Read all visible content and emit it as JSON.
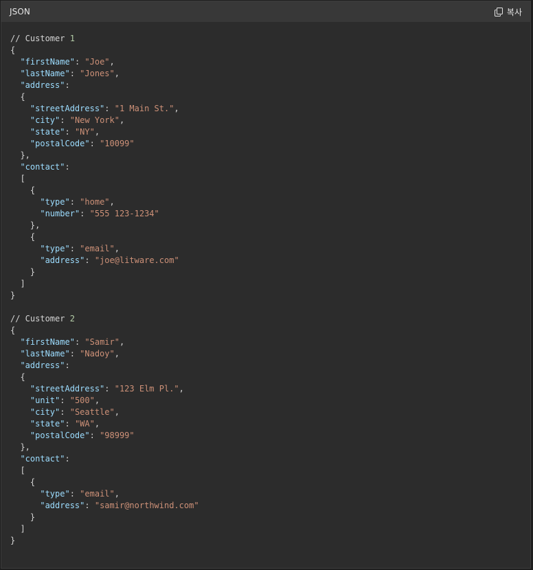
{
  "header": {
    "language": "JSON",
    "copy_label": "복사",
    "copy_icon": "copy-icon"
  },
  "colors": {
    "background": "#2c2c2c",
    "header_background": "#383838",
    "key": "#9cdcfe",
    "string": "#ce9178",
    "number": "#b5cea8",
    "text": "#d4d4d4"
  },
  "code_lines": [
    [
      {
        "t": "comment",
        "v": "// Customer "
      },
      {
        "t": "num",
        "v": "1"
      }
    ],
    [
      {
        "t": "punc",
        "v": "{"
      }
    ],
    [
      {
        "t": "punc",
        "v": "  "
      },
      {
        "t": "key",
        "v": "\"firstName\""
      },
      {
        "t": "punc",
        "v": ": "
      },
      {
        "t": "str",
        "v": "\"Joe\""
      },
      {
        "t": "punc",
        "v": ","
      }
    ],
    [
      {
        "t": "punc",
        "v": "  "
      },
      {
        "t": "key",
        "v": "\"lastName\""
      },
      {
        "t": "punc",
        "v": ": "
      },
      {
        "t": "str",
        "v": "\"Jones\""
      },
      {
        "t": "punc",
        "v": ","
      }
    ],
    [
      {
        "t": "punc",
        "v": "  "
      },
      {
        "t": "key",
        "v": "\"address\""
      },
      {
        "t": "punc",
        "v": ":"
      }
    ],
    [
      {
        "t": "punc",
        "v": "  {"
      }
    ],
    [
      {
        "t": "punc",
        "v": "    "
      },
      {
        "t": "key",
        "v": "\"streetAddress\""
      },
      {
        "t": "punc",
        "v": ": "
      },
      {
        "t": "str",
        "v": "\"1 Main St.\""
      },
      {
        "t": "punc",
        "v": ","
      }
    ],
    [
      {
        "t": "punc",
        "v": "    "
      },
      {
        "t": "key",
        "v": "\"city\""
      },
      {
        "t": "punc",
        "v": ": "
      },
      {
        "t": "str",
        "v": "\"New York\""
      },
      {
        "t": "punc",
        "v": ","
      }
    ],
    [
      {
        "t": "punc",
        "v": "    "
      },
      {
        "t": "key",
        "v": "\"state\""
      },
      {
        "t": "punc",
        "v": ": "
      },
      {
        "t": "str",
        "v": "\"NY\""
      },
      {
        "t": "punc",
        "v": ","
      }
    ],
    [
      {
        "t": "punc",
        "v": "    "
      },
      {
        "t": "key",
        "v": "\"postalCode\""
      },
      {
        "t": "punc",
        "v": ": "
      },
      {
        "t": "str",
        "v": "\"10099\""
      }
    ],
    [
      {
        "t": "punc",
        "v": "  },"
      }
    ],
    [
      {
        "t": "punc",
        "v": "  "
      },
      {
        "t": "key",
        "v": "\"contact\""
      },
      {
        "t": "punc",
        "v": ":"
      }
    ],
    [
      {
        "t": "punc",
        "v": "  ["
      }
    ],
    [
      {
        "t": "punc",
        "v": "    {"
      }
    ],
    [
      {
        "t": "punc",
        "v": "      "
      },
      {
        "t": "key",
        "v": "\"type\""
      },
      {
        "t": "punc",
        "v": ": "
      },
      {
        "t": "str",
        "v": "\"home\""
      },
      {
        "t": "punc",
        "v": ","
      }
    ],
    [
      {
        "t": "punc",
        "v": "      "
      },
      {
        "t": "key",
        "v": "\"number\""
      },
      {
        "t": "punc",
        "v": ": "
      },
      {
        "t": "str",
        "v": "\"555 123-1234\""
      }
    ],
    [
      {
        "t": "punc",
        "v": "    },"
      }
    ],
    [
      {
        "t": "punc",
        "v": "    {"
      }
    ],
    [
      {
        "t": "punc",
        "v": "      "
      },
      {
        "t": "key",
        "v": "\"type\""
      },
      {
        "t": "punc",
        "v": ": "
      },
      {
        "t": "str",
        "v": "\"email\""
      },
      {
        "t": "punc",
        "v": ","
      }
    ],
    [
      {
        "t": "punc",
        "v": "      "
      },
      {
        "t": "key",
        "v": "\"address\""
      },
      {
        "t": "punc",
        "v": ": "
      },
      {
        "t": "str",
        "v": "\"joe@litware.com\""
      }
    ],
    [
      {
        "t": "punc",
        "v": "    }"
      }
    ],
    [
      {
        "t": "punc",
        "v": "  ]"
      }
    ],
    [
      {
        "t": "punc",
        "v": "}"
      }
    ],
    [
      {
        "t": "punc",
        "v": ""
      }
    ],
    [
      {
        "t": "comment",
        "v": "// Customer "
      },
      {
        "t": "num",
        "v": "2"
      }
    ],
    [
      {
        "t": "punc",
        "v": "{"
      }
    ],
    [
      {
        "t": "punc",
        "v": "  "
      },
      {
        "t": "key",
        "v": "\"firstName\""
      },
      {
        "t": "punc",
        "v": ": "
      },
      {
        "t": "str",
        "v": "\"Samir\""
      },
      {
        "t": "punc",
        "v": ","
      }
    ],
    [
      {
        "t": "punc",
        "v": "  "
      },
      {
        "t": "key",
        "v": "\"lastName\""
      },
      {
        "t": "punc",
        "v": ": "
      },
      {
        "t": "str",
        "v": "\"Nadoy\""
      },
      {
        "t": "punc",
        "v": ","
      }
    ],
    [
      {
        "t": "punc",
        "v": "  "
      },
      {
        "t": "key",
        "v": "\"address\""
      },
      {
        "t": "punc",
        "v": ":"
      }
    ],
    [
      {
        "t": "punc",
        "v": "  {"
      }
    ],
    [
      {
        "t": "punc",
        "v": "    "
      },
      {
        "t": "key",
        "v": "\"streetAddress\""
      },
      {
        "t": "punc",
        "v": ": "
      },
      {
        "t": "str",
        "v": "\"123 Elm Pl.\""
      },
      {
        "t": "punc",
        "v": ","
      }
    ],
    [
      {
        "t": "punc",
        "v": "    "
      },
      {
        "t": "key",
        "v": "\"unit\""
      },
      {
        "t": "punc",
        "v": ": "
      },
      {
        "t": "str",
        "v": "\"500\""
      },
      {
        "t": "punc",
        "v": ","
      }
    ],
    [
      {
        "t": "punc",
        "v": "    "
      },
      {
        "t": "key",
        "v": "\"city\""
      },
      {
        "t": "punc",
        "v": ": "
      },
      {
        "t": "str",
        "v": "\"Seattle\""
      },
      {
        "t": "punc",
        "v": ","
      }
    ],
    [
      {
        "t": "punc",
        "v": "    "
      },
      {
        "t": "key",
        "v": "\"state\""
      },
      {
        "t": "punc",
        "v": ": "
      },
      {
        "t": "str",
        "v": "\"WA\""
      },
      {
        "t": "punc",
        "v": ","
      }
    ],
    [
      {
        "t": "punc",
        "v": "    "
      },
      {
        "t": "key",
        "v": "\"postalCode\""
      },
      {
        "t": "punc",
        "v": ": "
      },
      {
        "t": "str",
        "v": "\"98999\""
      }
    ],
    [
      {
        "t": "punc",
        "v": "  },"
      }
    ],
    [
      {
        "t": "punc",
        "v": "  "
      },
      {
        "t": "key",
        "v": "\"contact\""
      },
      {
        "t": "punc",
        "v": ":"
      }
    ],
    [
      {
        "t": "punc",
        "v": "  ["
      }
    ],
    [
      {
        "t": "punc",
        "v": "    {"
      }
    ],
    [
      {
        "t": "punc",
        "v": "      "
      },
      {
        "t": "key",
        "v": "\"type\""
      },
      {
        "t": "punc",
        "v": ": "
      },
      {
        "t": "str",
        "v": "\"email\""
      },
      {
        "t": "punc",
        "v": ","
      }
    ],
    [
      {
        "t": "punc",
        "v": "      "
      },
      {
        "t": "key",
        "v": "\"address\""
      },
      {
        "t": "punc",
        "v": ": "
      },
      {
        "t": "str",
        "v": "\"samir@northwind.com\""
      }
    ],
    [
      {
        "t": "punc",
        "v": "    }"
      }
    ],
    [
      {
        "t": "punc",
        "v": "  ]"
      }
    ],
    [
      {
        "t": "punc",
        "v": "}"
      }
    ]
  ]
}
